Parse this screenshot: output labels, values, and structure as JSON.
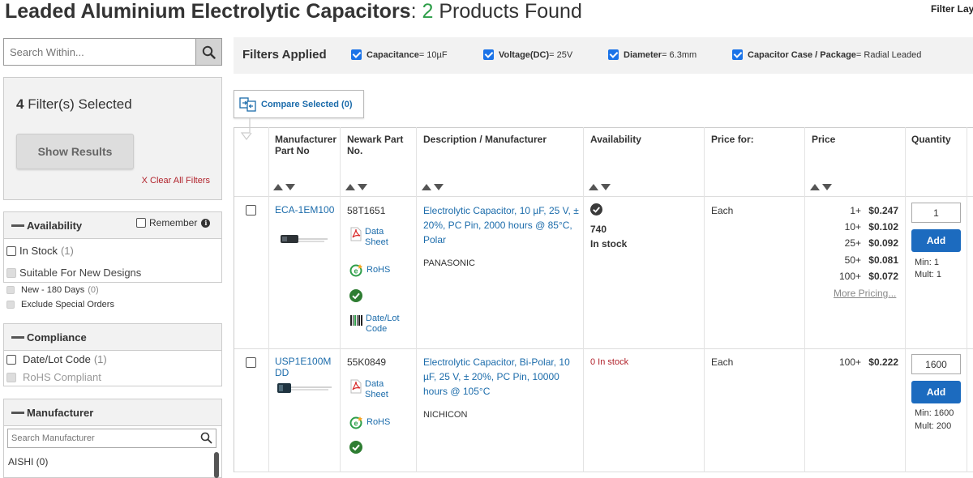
{
  "page": {
    "title": "Leaded Aluminium Electrolytic Capacitors",
    "sep": ": ",
    "count": "2",
    "found_text": " Products Found",
    "filter_layout": "Filter Layout"
  },
  "sidebar": {
    "search_placeholder": "Search Within...",
    "filters_selected_count": "4",
    "filters_selected_text": " Filter(s) Selected",
    "show_results": "Show Results",
    "clear_all": "X Clear All Filters",
    "availability": {
      "title": "Availability",
      "remember": "Remember",
      "in_stock": "In Stock",
      "in_stock_count": "(1)",
      "suitable": "Suitable For New Designs",
      "new_180": "New - 180 Days",
      "new_180_count": "(0)",
      "exclude_special": "Exclude Special Orders"
    },
    "compliance": {
      "title": "Compliance",
      "date_lot": "Date/Lot Code",
      "date_lot_count": "(1)",
      "rohs": "RoHS Compliant"
    },
    "manufacturer": {
      "title": "Manufacturer",
      "search_placeholder": "Search Manufacturer",
      "first_item": "AISHI (0)"
    }
  },
  "filters_applied": {
    "title": "Filters Applied",
    "chips": [
      {
        "key": "Capacitance",
        "value": " = 10µF"
      },
      {
        "key": "Voltage(DC)",
        "value": " = 25V"
      },
      {
        "key": "Diameter",
        "value": " = 6.3mm"
      },
      {
        "key": "Capacitor Case / Package",
        "value": " = Radial Leaded"
      }
    ]
  },
  "compare": {
    "label": "Compare Selected (0)"
  },
  "table": {
    "headers": {
      "mfr_part": "Manufacturer Part No",
      "newark_part": "Newark Part No.",
      "desc": "Description / Manufacturer",
      "availability": "Availability",
      "price_for": "Price for:",
      "price": "Price",
      "quantity": "Quantity"
    },
    "rows": [
      {
        "mfr_part": "ECA-1EM100",
        "newark_part": "58T1651",
        "datasheet": "Data Sheet",
        "rohs": "RoHS",
        "datelot": "Date/Lot Code",
        "description": "Electrolytic Capacitor, 10 µF, 25 V, ± 20%, PC Pin, 2000 hours @ 85°C, Polar",
        "manufacturer": "PANASONIC",
        "stock_qty": "740",
        "stock_text": "In stock",
        "price_for": "Each",
        "prices": [
          {
            "break": "1+",
            "price": "$0.247"
          },
          {
            "break": "10+",
            "price": "$0.102"
          },
          {
            "break": "25+",
            "price": "$0.092"
          },
          {
            "break": "50+",
            "price": "$0.081"
          },
          {
            "break": "100+",
            "price": "$0.072"
          }
        ],
        "more_pricing": "More Pricing...",
        "qty": "1",
        "add": "Add",
        "min": "Min: 1",
        "mult": "Mult: 1"
      },
      {
        "mfr_part": "USP1E100MDD",
        "newark_part": "55K0849",
        "datasheet": "Data Sheet",
        "rohs": "RoHS",
        "description": "Electrolytic Capacitor, Bi-Polar, 10 µF, 25 V, ± 20%, PC Pin, 10000 hours @ 105°C",
        "manufacturer": "NICHICON",
        "stock_text": "0 In stock",
        "price_for": "Each",
        "prices": [
          {
            "break": "100+",
            "price": "$0.222"
          }
        ],
        "qty": "1600",
        "add": "Add",
        "min": "Min: 1600",
        "mult": "Mult: 200"
      }
    ]
  },
  "colors": {
    "accent": "#1c6cab",
    "success": "#2e9e49",
    "danger": "#b1232c",
    "button": "#1c6bbf"
  }
}
